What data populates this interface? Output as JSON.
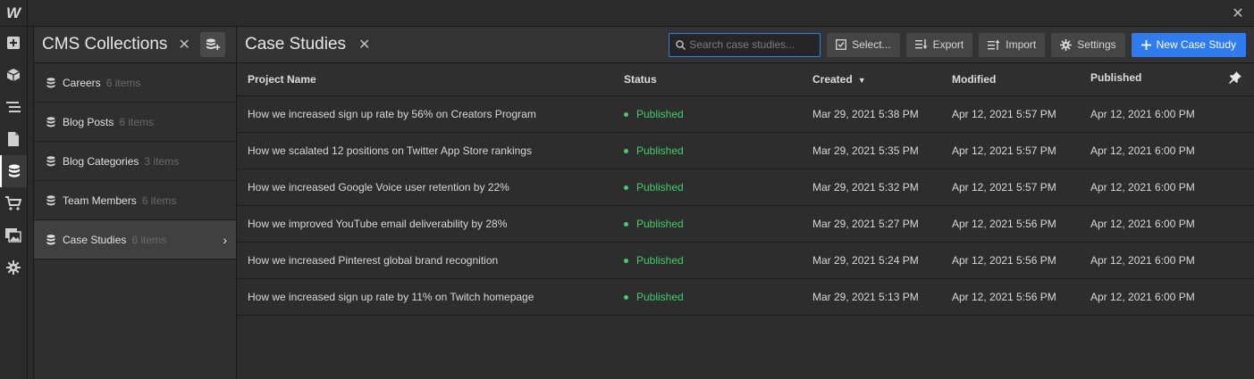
{
  "app": {
    "logo": "W"
  },
  "collections": {
    "title": "CMS Collections",
    "items": [
      {
        "name": "Careers",
        "count": "6 items"
      },
      {
        "name": "Blog Posts",
        "count": "6 items"
      },
      {
        "name": "Blog Categories",
        "count": "3 items"
      },
      {
        "name": "Team Members",
        "count": "6 items"
      },
      {
        "name": "Case Studies",
        "count": "6 items"
      }
    ]
  },
  "main": {
    "title": "Case Studies",
    "search_placeholder": "Search case studies...",
    "buttons": {
      "select": "Select...",
      "export": "Export",
      "import": "Import",
      "settings": "Settings",
      "new": "New Case Study"
    },
    "columns": [
      "Project Name",
      "Status",
      "Created",
      "Modified",
      "Published"
    ],
    "rows": [
      {
        "name": "How we increased sign up rate by 56% on Creators Program",
        "status": "Published",
        "created": "Mar 29, 2021 5:38 PM",
        "modified": "Apr 12, 2021 5:57 PM",
        "published": "Apr 12, 2021 6:00 PM"
      },
      {
        "name": "How we scalated 12 positions on Twitter App Store rankings",
        "status": "Published",
        "created": "Mar 29, 2021 5:35 PM",
        "modified": "Apr 12, 2021 5:57 PM",
        "published": "Apr 12, 2021 6:00 PM"
      },
      {
        "name": "How we increased Google Voice user retention by 22%",
        "status": "Published",
        "created": "Mar 29, 2021 5:32 PM",
        "modified": "Apr 12, 2021 5:57 PM",
        "published": "Apr 12, 2021 6:00 PM"
      },
      {
        "name": "How we improved YouTube email deliverability by 28%",
        "status": "Published",
        "created": "Mar 29, 2021 5:27 PM",
        "modified": "Apr 12, 2021 5:56 PM",
        "published": "Apr 12, 2021 6:00 PM"
      },
      {
        "name": "How we increased Pinterest global brand recognition",
        "status": "Published",
        "created": "Mar 29, 2021 5:24 PM",
        "modified": "Apr 12, 2021 5:56 PM",
        "published": "Apr 12, 2021 6:00 PM"
      },
      {
        "name": "How we increased sign up rate by 11% on Twitch homepage",
        "status": "Published",
        "created": "Mar 29, 2021 5:13 PM",
        "modified": "Apr 12, 2021 5:56 PM",
        "published": "Apr 12, 2021 6:00 PM"
      }
    ]
  },
  "colors": {
    "accent": "#2f7bf0",
    "status_published": "#3ecf6a"
  }
}
